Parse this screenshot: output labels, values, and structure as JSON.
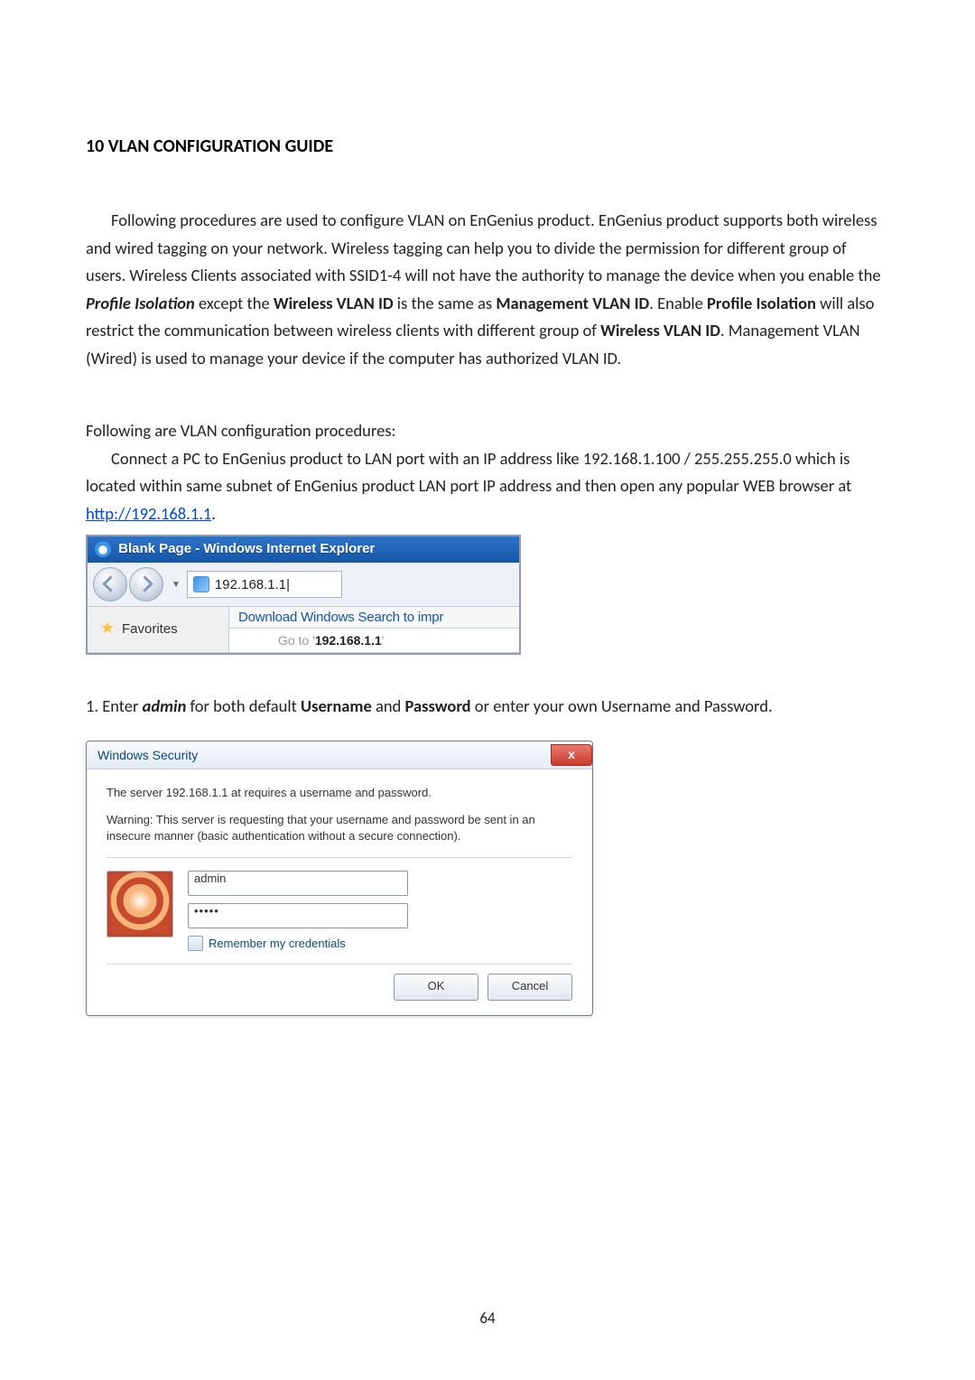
{
  "heading": "10 VLAN CONFIGURATION GUIDE",
  "para1_prefix": "Following procedures are used to configure VLAN on EnGenius product. EnGenius product supports both wireless and wired tagging on your network. Wireless tagging can help you to divide the permission for different group of users. Wireless Clients associated with SSID1-4 will not have the authority to manage the device when you enable the ",
  "para1_bi1": "Profile Isolation",
  "para1_mid1": " except the ",
  "para1_b1": "Wireless VLAN ID",
  "para1_mid2": " is the same as ",
  "para1_b2": "Management VLAN ID",
  "para1_mid3": ". Enable ",
  "para1_b3": "Profile Isolation",
  "para1_mid4": " will also restrict the communication between wireless clients with different group of ",
  "para1_b4": "Wireless VLAN ID",
  "para1_suffix": ". Management VLAN (Wired) is used to manage your device if the computer has authorized VLAN ID.",
  "para2_line1": "Following are VLAN configuration procedures:",
  "para2_body": "Connect a PC to EnGenius product to LAN port with an IP address like 192.168.1.100 / 255.255.255.0 which is located within same subnet of EnGenius product LAN port IP address and then open any popular WEB browser at ",
  "para2_link": "http://192.168.1.1",
  "para2_period": ".",
  "ie": {
    "title": "Blank Page - Windows Internet Explorer",
    "address": "192.168.1.1|",
    "download_bar": "Download Windows Search to impr",
    "favorites": "Favorites",
    "goto_prefix": "Go to '",
    "goto_ip": "192.168.1.1",
    "goto_suffix": "'"
  },
  "step1_prefix": "1. Enter ",
  "step1_bi": "admin",
  "step1_mid1": " for both default ",
  "step1_b1": "Username",
  "step1_mid2": " and ",
  "step1_b2": "Password",
  "step1_suffix": " or enter your own Username and Password.",
  "winsec": {
    "title": "Windows Security",
    "close": "x",
    "msg1": "The server 192.168.1.1 at  requires a username and password.",
    "msg2": "Warning: This server is requesting that your username and password be sent in an insecure manner (basic authentication without a secure connection).",
    "username_value": "admin",
    "password_value": "•••••",
    "remember": "Remember my credentials",
    "ok": "OK",
    "cancel": "Cancel"
  },
  "page_number": "64"
}
